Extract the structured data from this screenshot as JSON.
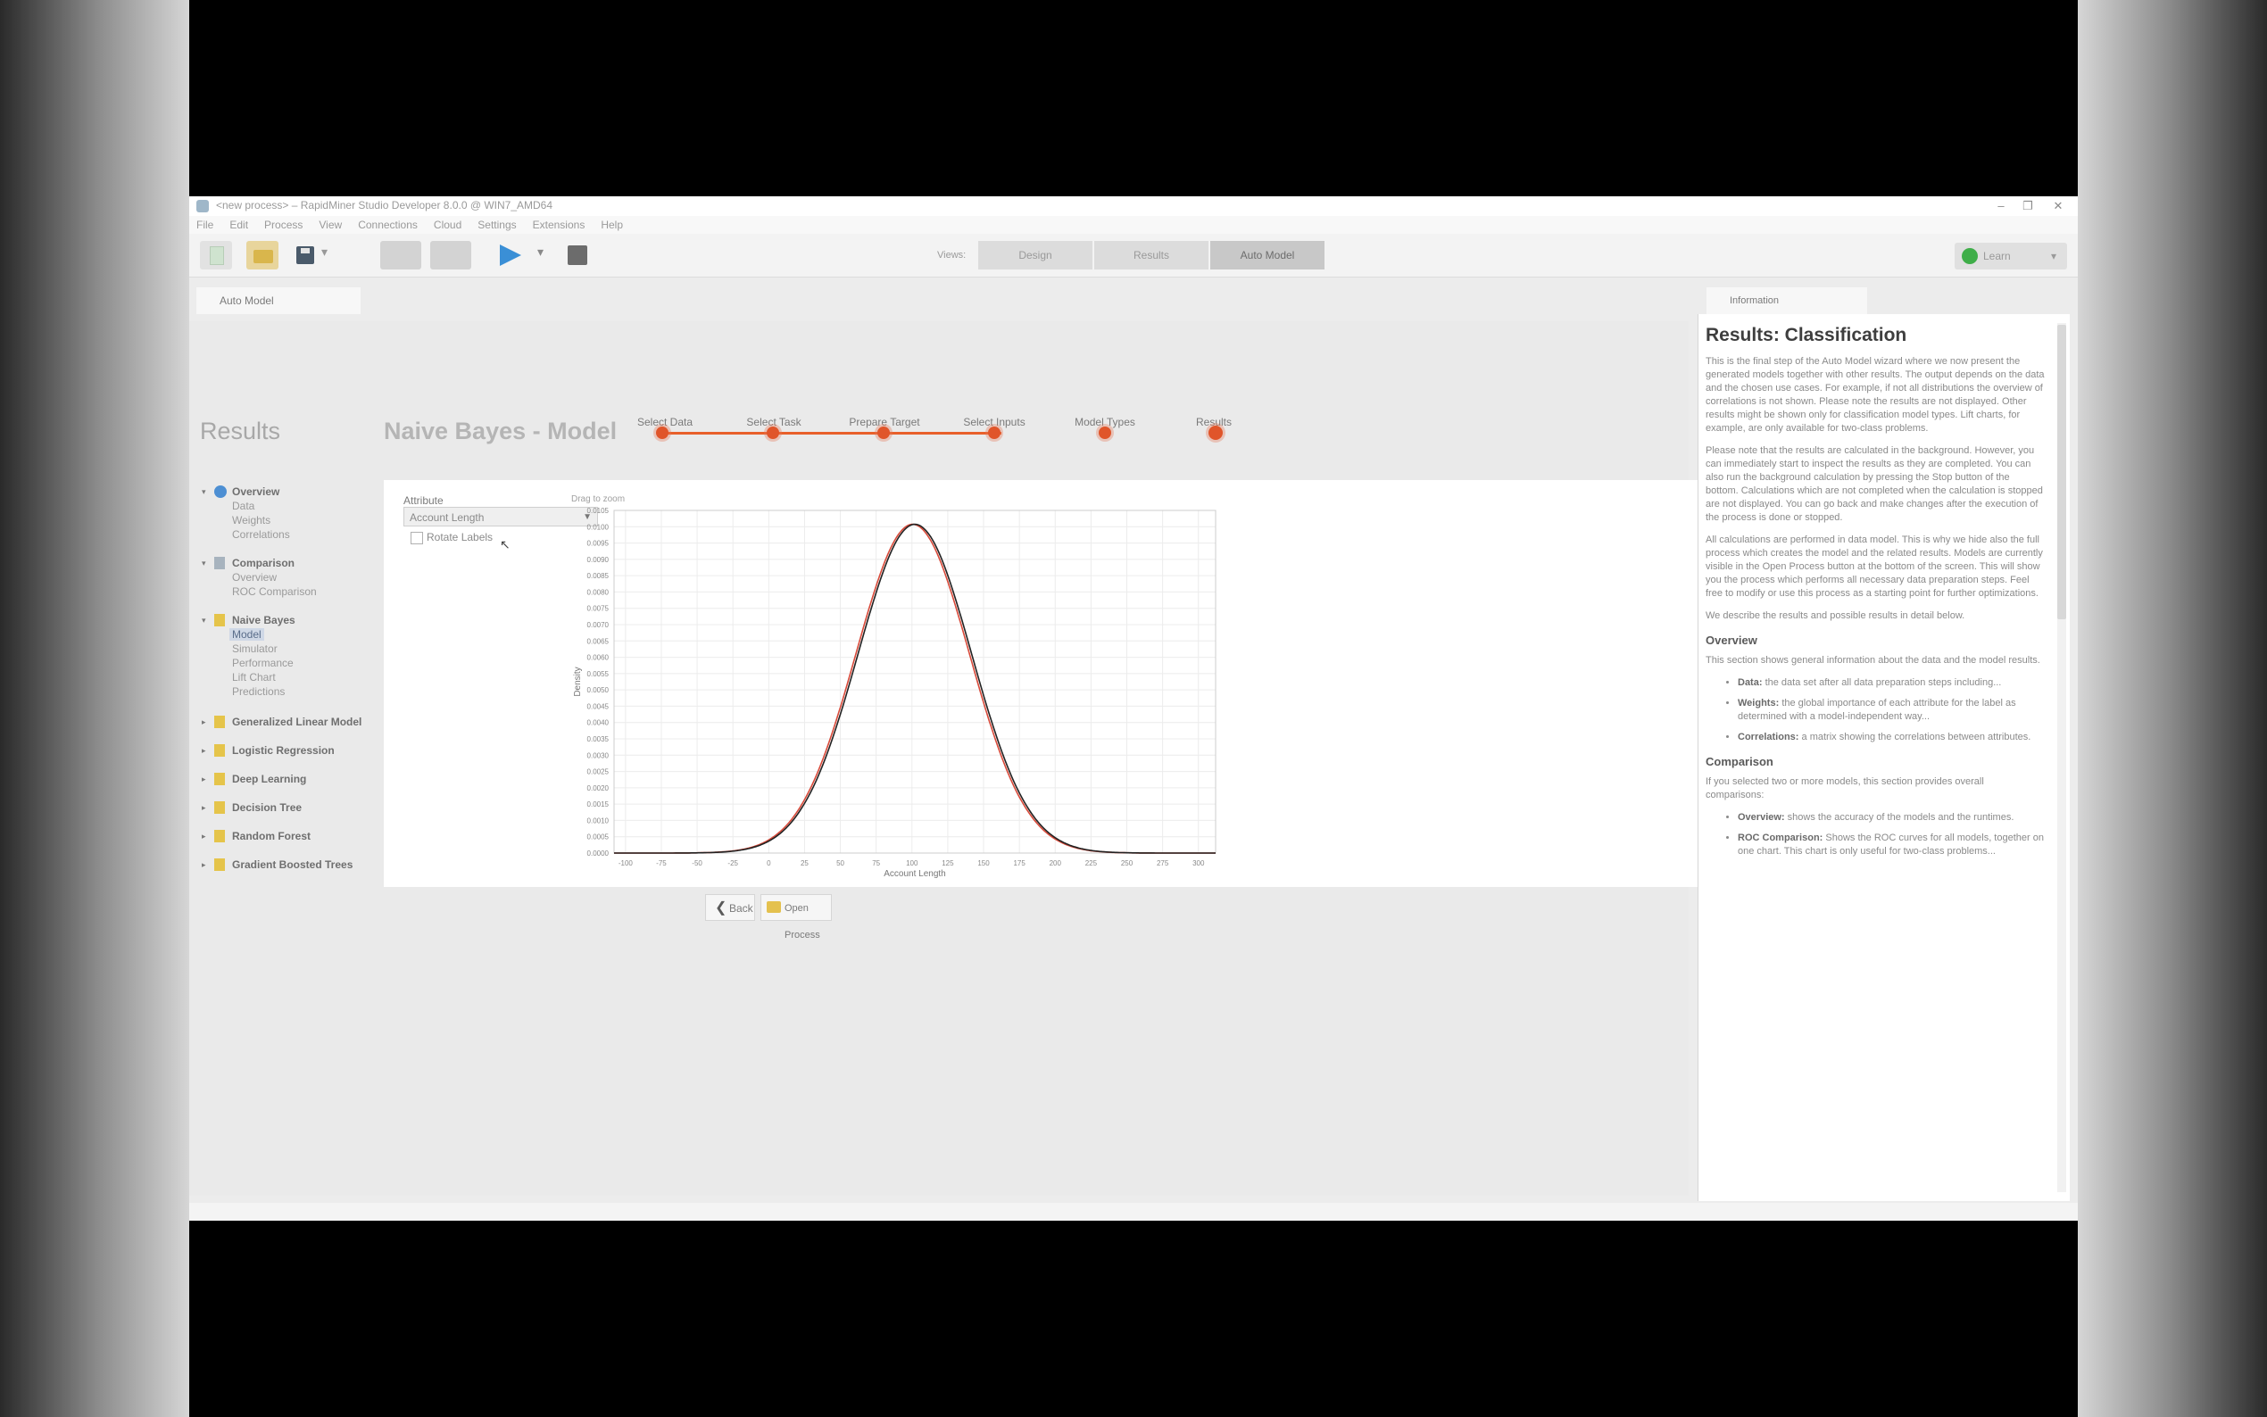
{
  "window": {
    "title": "<new process> – RapidMiner Studio Developer 8.0.0 @ WIN7_AMD64",
    "minimize": "–",
    "maximize": "❐",
    "close": "✕"
  },
  "menu": [
    "File",
    "Edit",
    "Process",
    "View",
    "Connections",
    "Cloud",
    "Settings",
    "Extensions",
    "Help"
  ],
  "toolbar": {
    "views_label": "Views:",
    "views": [
      "Design",
      "Results",
      "Auto Model"
    ],
    "active_view": "Auto Model",
    "learn_label": "Learn",
    "learn_caret": "▾",
    "save_caret": "▾",
    "play_caret": "▾"
  },
  "tabs": {
    "main": "Auto Model",
    "info": "Information"
  },
  "stepper": {
    "steps": [
      "Select Data",
      "Select Task",
      "Prepare Target",
      "Select Inputs",
      "Model Types",
      "Results"
    ],
    "active_index": 5
  },
  "results": {
    "heading": "Results",
    "title": "Naive Bayes - Model",
    "nav": [
      {
        "label": "Overview",
        "children": [
          "Data",
          "Weights",
          "Correlations"
        ]
      },
      {
        "label": "Comparison",
        "children": [
          "Overview",
          "ROC Comparison"
        ]
      },
      {
        "label": "Naive Bayes",
        "children": [
          "Model",
          "Simulator",
          "Performance",
          "Lift Chart",
          "Predictions"
        ]
      },
      {
        "label": "Generalized Linear Model",
        "children": []
      },
      {
        "label": "Logistic Regression",
        "children": []
      },
      {
        "label": "Deep Learning",
        "children": []
      },
      {
        "label": "Decision Tree",
        "children": []
      },
      {
        "label": "Random Forest",
        "children": []
      },
      {
        "label": "Gradient Boosted Trees",
        "children": []
      }
    ],
    "selected_item": "Model"
  },
  "model_view": {
    "attribute_label": "Attribute",
    "attribute_value": "Account Length",
    "rotate_label": "Rotate Labels",
    "rotate_checked": false,
    "zoom_hint": "Drag to zoom"
  },
  "chart_data": {
    "type": "line",
    "xlabel": "Account Length",
    "ylabel": "Density",
    "x_ticks": [
      -100,
      -75,
      -50,
      -25,
      0,
      25,
      50,
      75,
      100,
      125,
      150,
      175,
      200,
      225,
      250,
      275,
      300
    ],
    "xlim": [
      -108,
      312
    ],
    "ylim": [
      0,
      0.0105
    ],
    "y_ticks": [
      0,
      0.0005,
      0.001,
      0.0015,
      0.002,
      0.0025,
      0.003,
      0.0035,
      0.004,
      0.0045,
      0.005,
      0.0055,
      0.006,
      0.0065,
      0.007,
      0.0075,
      0.008,
      0.0085,
      0.009,
      0.0095,
      0.01,
      0.0105
    ],
    "grid": true,
    "series": [
      {
        "distribution": "normal",
        "mean": 100.5,
        "sd": 39.6,
        "color": "#d84a3a"
      },
      {
        "distribution": "normal",
        "mean": 102.0,
        "sd": 39.6,
        "color": "#222222"
      }
    ]
  },
  "buttons": {
    "back": "Back",
    "open_process": "Open Process"
  },
  "information": {
    "title": "Results: Classification",
    "paragraphs": [
      "This is the final step of the Auto Model wizard where we now present the generated models together with other results. The output depends on the data and the chosen use cases. For example, if not all distributions the overview of correlations is not shown. Please note the results are not displayed. Other results might be shown only for classification model types. Lift charts, for example, are only available for two-class problems.",
      "Please note that the results are calculated in the background. However, you can immediately start to inspect the results as they are completed. You can also run the background calculation by pressing the Stop button of the bottom. Calculations which are not completed when the calculation is stopped are not displayed. You can go back and make changes after the execution of the process is done or stopped.",
      "All calculations are performed in data model. This is why we hide also the full process which creates the model and the related results. Models are currently visible in the Open Process button at the bottom of the screen. This will show you the process which performs all necessary data preparation steps. Feel free to modify or use this process as a starting point for further optimizations.",
      "We describe the results and possible results in detail below."
    ],
    "overview_heading": "Overview",
    "overview_text": "This section shows general information about the data and the model results.",
    "overview_items": [
      {
        "term": "Data:",
        "text": "the data set after all data preparation steps including..."
      },
      {
        "term": "Weights:",
        "text": "the global importance of each attribute for the label as determined with a model-independent way..."
      },
      {
        "term": "Correlations:",
        "text": "a matrix showing the correlations between attributes."
      }
    ],
    "comparison_heading": "Comparison",
    "comparison_text": "If you selected two or more models, this section provides overall comparisons:",
    "comparison_items": [
      {
        "term": "Overview:",
        "text": "shows the accuracy of the models and the runtimes."
      },
      {
        "term": "ROC Comparison:",
        "text": "Shows the ROC curves for all models, together on one chart. This chart is only useful for two-class problems..."
      }
    ]
  }
}
